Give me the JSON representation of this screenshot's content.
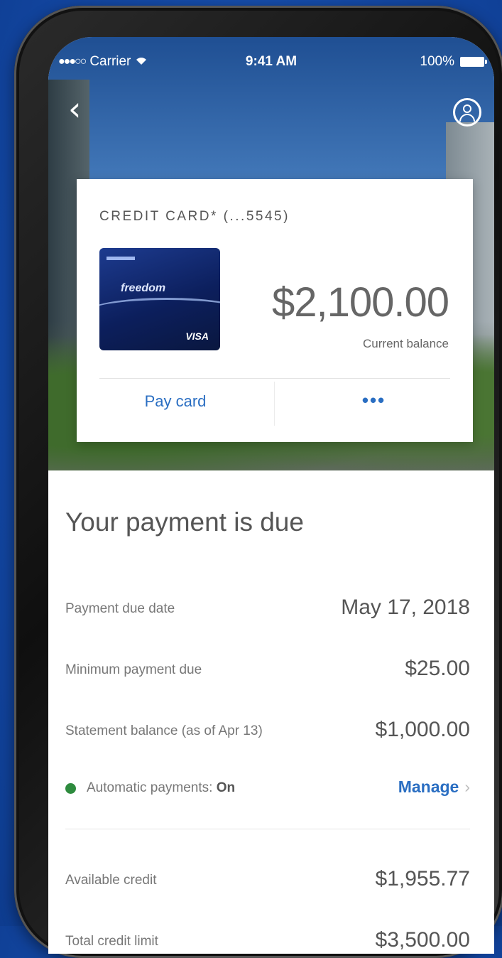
{
  "status_bar": {
    "carrier": "Carrier",
    "time": "9:41 AM",
    "battery": "100%"
  },
  "icons": {
    "back": "chevron-left-icon",
    "profile": "profile-icon",
    "signal": "signal-icon",
    "wifi": "wifi-icon",
    "battery": "battery-icon"
  },
  "card": {
    "title": "CREDIT CARD* (...5545)",
    "balance": "$2,100.00",
    "balance_label": "Current balance",
    "pay_button": "Pay card",
    "more_button": "•••",
    "image_brand": "freedom",
    "image_network": "VISA"
  },
  "payment": {
    "section_title": "Your payment is due",
    "due_date_label": "Payment due date",
    "due_date_value": "May 17, 2018",
    "minimum_label": "Minimum payment due",
    "minimum_value": "$25.00",
    "statement_label": "Statement balance (as of Apr 13)",
    "statement_value": "$1,000.00",
    "autopay_label": "Automatic payments: ",
    "autopay_status": "On",
    "manage_label": "Manage"
  },
  "credit": {
    "available_label": "Available credit",
    "available_value": "$1,955.77",
    "limit_label": "Total credit limit",
    "limit_value": "$3,500.00"
  },
  "colors": {
    "accent": "#2a6ec2",
    "status_on": "#2e8b3e",
    "background": "#1449a6"
  }
}
